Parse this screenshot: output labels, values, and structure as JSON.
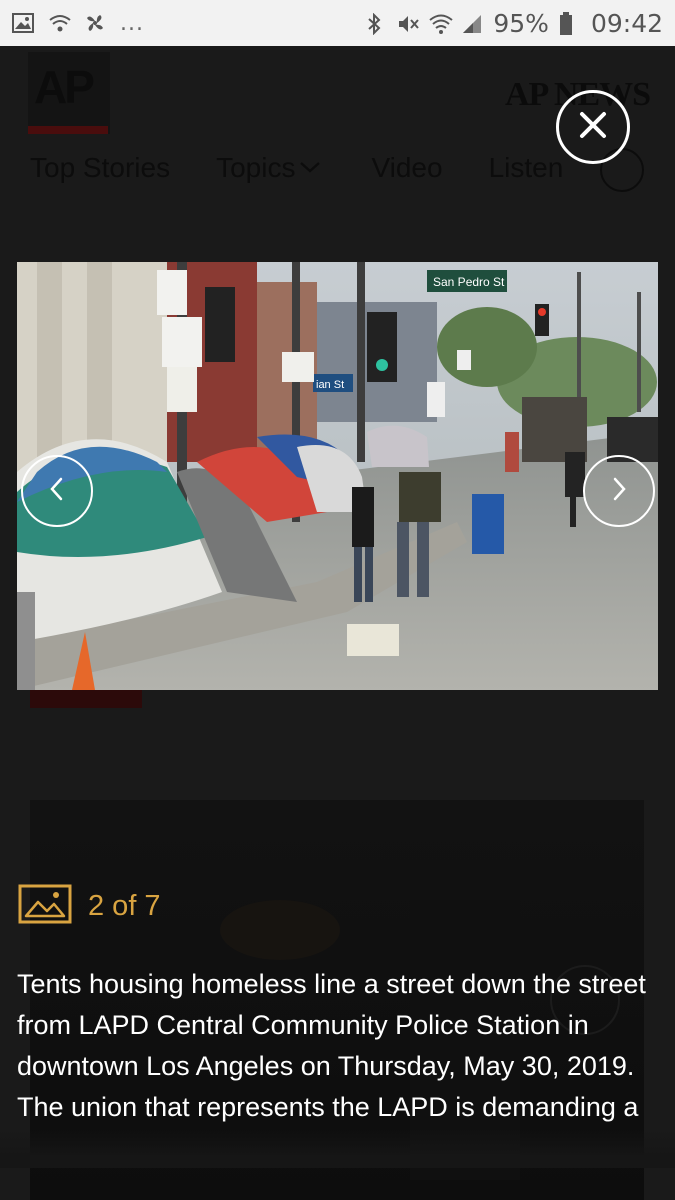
{
  "status_bar": {
    "battery": "95%",
    "time": "09:42",
    "overflow": "..."
  },
  "background_page": {
    "logo_text": "AP",
    "brand_text": "AP NEWS",
    "nav_items": [
      "Top Stories",
      "Topics",
      "Video",
      "Listen"
    ],
    "topics_chevron": "chevron-down-icon"
  },
  "gallery": {
    "current": "2 of 7",
    "caption": "Tents housing homeless line a street down the street from LAPD Central Community Police Station in downtown Los Angeles on Thursday, May 30, 2019. The union that represents the LAPD is demanding a",
    "photo_sign_street": "San Pedro St",
    "photo_sign_street2": "ian St",
    "accent_color": "#d9a441"
  }
}
